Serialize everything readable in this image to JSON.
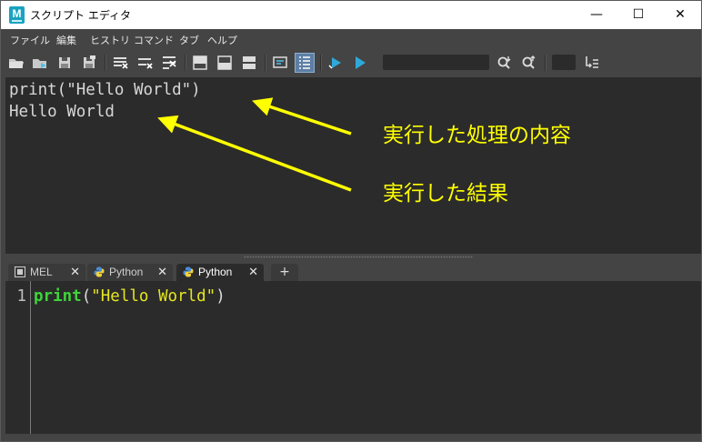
{
  "window": {
    "title": "スクリプト エディタ",
    "app_icon_letter": "M",
    "minimize_glyph": "—",
    "maximize_glyph": "☐",
    "close_glyph": "✕"
  },
  "menu": {
    "items": [
      "ファイル",
      "編集",
      "ヒストリ",
      "コマンド",
      "タブ",
      "ヘルプ"
    ]
  },
  "toolbar": {
    "icons": [
      "open-script-icon",
      "source-script-icon",
      "save-script-icon",
      "save-script-to-shelf-icon",
      "clear-history-icon",
      "clear-input-icon",
      "clear-all-icon",
      "show-history-only-icon",
      "show-input-only-icon",
      "show-both-icon",
      "echo-all-commands-icon",
      "line-numbers-icon",
      "execute-all-icon",
      "execute-icon"
    ],
    "search_value": "",
    "search_icons": [
      "search-next-icon",
      "search-previous-icon"
    ],
    "goto_line_value": "",
    "goto_line_icon": "goto-line-icon"
  },
  "output": {
    "lines": [
      "print(\"Hello World\")",
      "Hello World"
    ]
  },
  "annotations": {
    "process_label": "実行した処理の内容",
    "result_label": "実行した結果",
    "color": "#ffff00"
  },
  "tabs": [
    {
      "icon": "mel-icon",
      "label": "MEL",
      "close": "✕",
      "active": false
    },
    {
      "icon": "python-icon",
      "label": "Python",
      "close": "✕",
      "active": false
    },
    {
      "icon": "python-icon",
      "label": "Python",
      "close": "✕",
      "active": true
    }
  ],
  "add_tab_label": "+",
  "editor": {
    "line_number": "1",
    "code_keyword": "print",
    "code_open": "(",
    "code_string": "\"Hello World\"",
    "code_close": ")",
    "colors": {
      "keyword": "#3fd33a",
      "string": "#e5e522",
      "punct": "#dcdcdc"
    }
  }
}
